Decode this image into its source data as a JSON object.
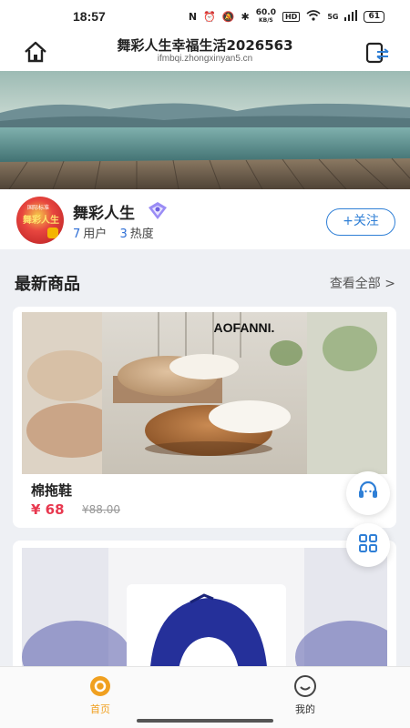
{
  "status_bar": {
    "time": "18:57",
    "network_speed": "60.0",
    "speed_unit": "KB/S",
    "hd": "HD",
    "signal": "5G",
    "battery": "61"
  },
  "header": {
    "title": "舞彩人生幸福生活2026563",
    "subtitle": "ifmbqi.zhongxinyan5.cn"
  },
  "profile": {
    "name": "舞彩人生",
    "avatar_text": "舞彩人生",
    "avatar_small": "国际标准",
    "users_count": "7",
    "users_label": "用户",
    "heat_count": "3",
    "heat_label": "热度",
    "follow_label": "+关注"
  },
  "section": {
    "title": "最新商品",
    "more_label": "查看全部 >"
  },
  "products": [
    {
      "name": "棉拖鞋",
      "price": "¥ 68",
      "original_price": "¥88.00",
      "brand_text": "AOFANNI."
    }
  ],
  "bottom_nav": {
    "home_label": "首页",
    "mine_label": "我的"
  },
  "colors": {
    "accent": "#2f7fd6",
    "price": "#e8384f",
    "home_tab": "#f0a020"
  }
}
